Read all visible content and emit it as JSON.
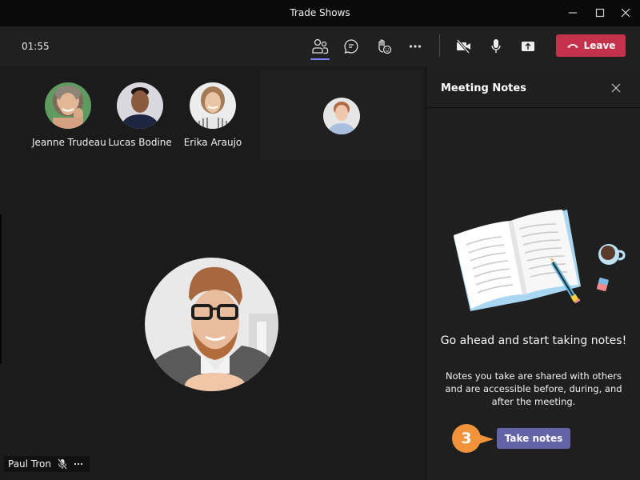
{
  "window": {
    "title": "Trade Shows",
    "controls": [
      "minimize-icon",
      "maximize-icon",
      "close-icon"
    ]
  },
  "toolbar": {
    "timer": "01:55",
    "buttons": [
      {
        "icon": "participants-icon",
        "active": true
      },
      {
        "icon": "chat-icon",
        "active": false
      },
      {
        "icon": "raise-hand-icon",
        "active": false
      },
      {
        "icon": "more-options-icon",
        "active": false
      },
      {
        "icon": "camera-off-icon",
        "active": false
      },
      {
        "icon": "microphone-icon",
        "active": false
      },
      {
        "icon": "share-screen-icon",
        "active": false
      }
    ],
    "leave_label": "Leave",
    "leave_color": "#c4314b"
  },
  "participants": [
    {
      "name": "Jeanne Trudeau"
    },
    {
      "name": "Lucas Bodine"
    },
    {
      "name": "Erika Araujo"
    }
  ],
  "main_speaker": {
    "name": "Paul Tron",
    "muted": true
  },
  "panel": {
    "title": "Meeting Notes",
    "headline": "Go ahead and start taking notes!",
    "description": "Notes you take are shared with others and are accessible before, during, and after the meeting.",
    "button_label": "Take notes",
    "button_color": "#6264a7",
    "step_number": "3",
    "step_color": "#f0933a"
  }
}
